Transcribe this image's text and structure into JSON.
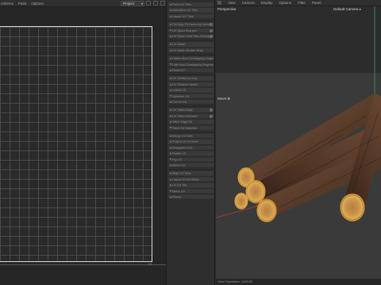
{
  "uv_editor": {
    "menu": [
      "nsforms",
      "Paint",
      "Options"
    ],
    "selector": "Project",
    "corner_label": "1.0"
  },
  "tools_panel": {
    "rows": [
      {
        "label": "Paint UV Tiles",
        "option": false
      },
      {
        "label": "Normalize UV Tiles",
        "option": false
      },
      {
        "label": "Layout UV Tiles",
        "option": false
      },
      {
        "label": "Full Map Fit Faces by Normal",
        "option": true
      },
      {
        "label": "UV Quad Sharpen",
        "option": true
      },
      {
        "label": "UV Match Grid Tiles Overlay",
        "option": true
      },
      {
        "label": "UV Match",
        "option": false
      },
      {
        "label": "UV Match Rotate Wrap",
        "option": false
      },
      {
        "label": "Flatten Non-Overlapping Segments",
        "option": false
      },
      {
        "label": "Hide Non-Overlapping Segments",
        "option": false
      },
      {
        "label": "Stack UV",
        "option": false
      },
      {
        "label": "UV Gridify by Crop",
        "option": false
      },
      {
        "label": "UV Sharpen Spline",
        "option": false
      },
      {
        "label": "Unfold UV",
        "option": false
      },
      {
        "label": "Optimize UV",
        "option": false
      },
      {
        "label": "Cut UV Ed",
        "option": false
      },
      {
        "label": "UV Stitch Edge",
        "option": true
      },
      {
        "label": "UV Stitch Selected",
        "option": true
      },
      {
        "label": "Stitch Edge Ed",
        "option": false
      },
      {
        "label": "Stitch Ed Selected",
        "option": false
      },
      {
        "label": "Merge UV Sets",
        "option": false
      },
      {
        "label": "Project UV to Mesh",
        "option": false
      },
      {
        "label": "Straighten UVs",
        "option": false
      },
      {
        "label": "Rotate UV",
        "option": false
      },
      {
        "label": "Flip UV",
        "option": false
      },
      {
        "label": "Mirror UV",
        "option": false
      },
      {
        "label": "Align UV Sets",
        "option": false
      },
      {
        "label": "Layout UV Ed Mesh",
        "option": false
      },
      {
        "label": "UV Ed Tile",
        "option": false
      },
      {
        "label": "Mirror UV",
        "option": false
      },
      {
        "label": "Planar",
        "option": false
      }
    ]
  },
  "viewport": {
    "menu": [
      "View",
      "Camera",
      "Display",
      "Options",
      "Filter",
      "Panel"
    ],
    "view_label": "Perspective",
    "camera_label": "Default Camera",
    "tool_label": "Move",
    "status_text": "View Transform: 1/sRGB"
  },
  "colors": {
    "accent_grid_border": "#d9d9d9",
    "bark_dark": "#3e2a1e",
    "bark_light": "#6b4a34",
    "log_cut_face": "#d9a441",
    "axis_green": "#3c9b6e",
    "axis_red": "#b8403a"
  }
}
